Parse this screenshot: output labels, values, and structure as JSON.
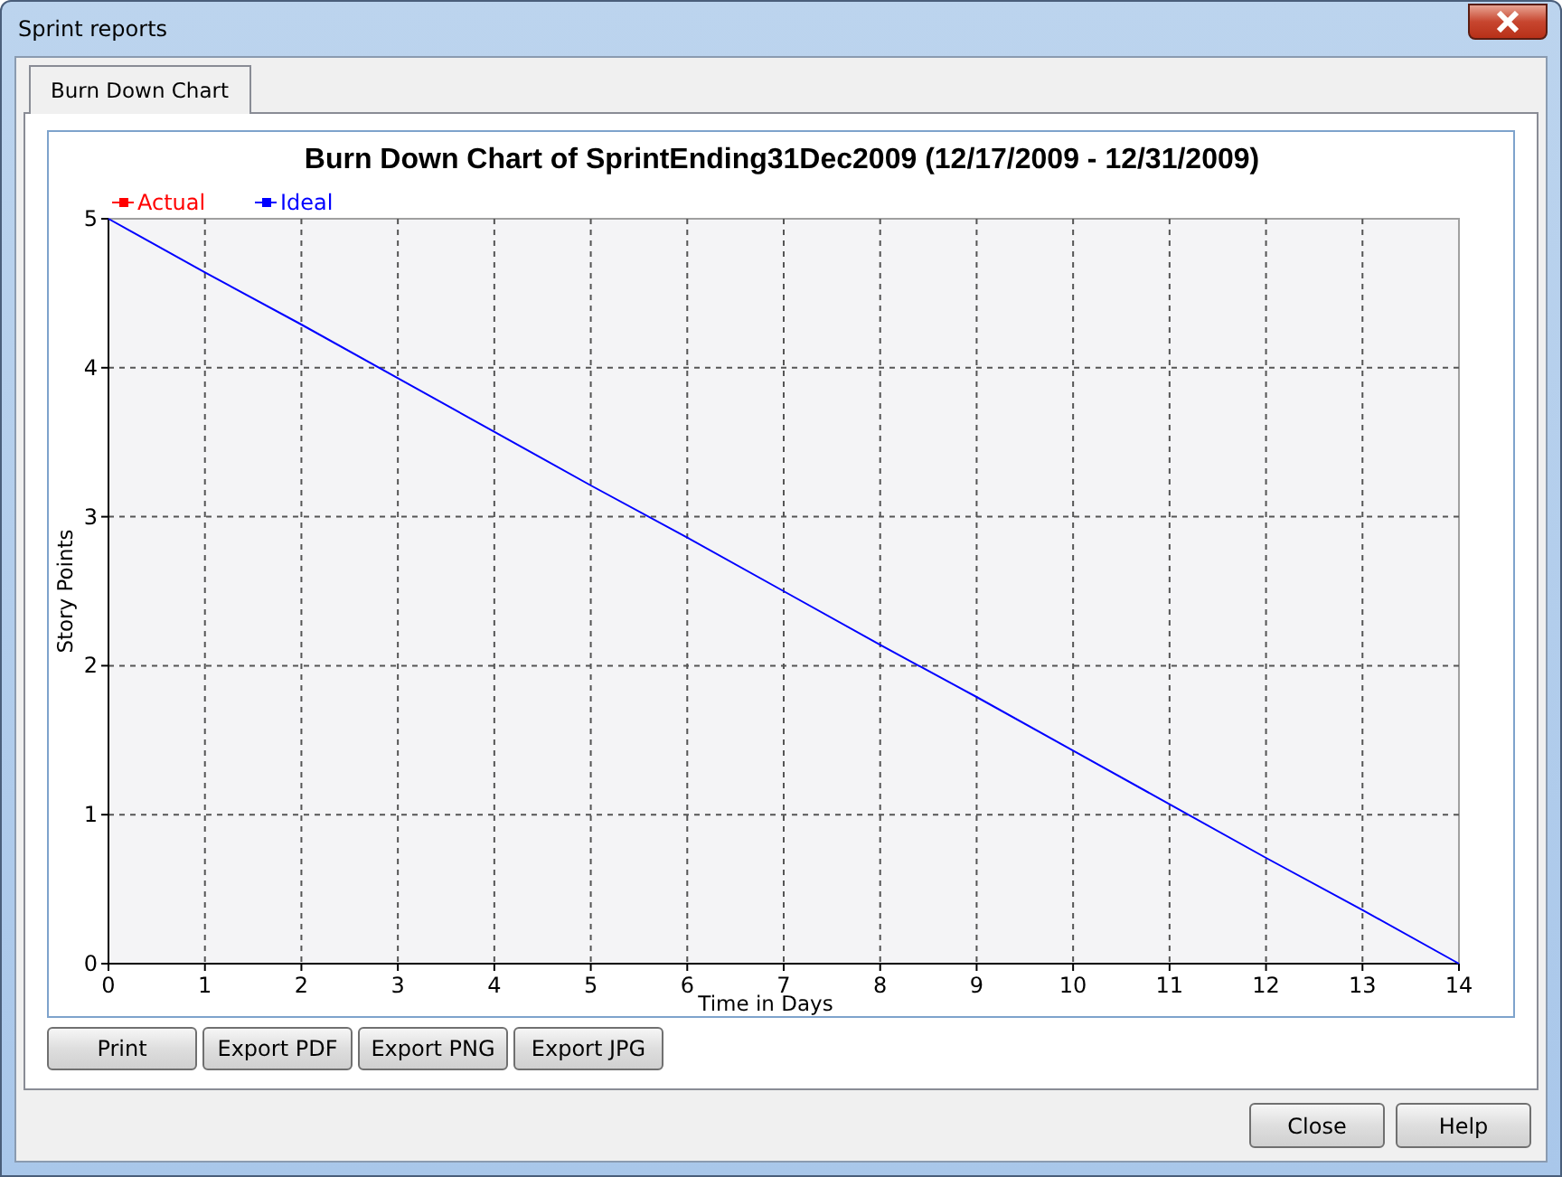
{
  "window": {
    "title": "Sprint reports"
  },
  "tabs": [
    {
      "label": "Burn Down Chart",
      "selected": true
    }
  ],
  "chart_data": {
    "type": "line",
    "title": "Burn Down Chart of SprintEnding31Dec2009 (12/17/2009 - 12/31/2009)",
    "xlabel": "Time in Days",
    "ylabel": "Story Points",
    "x": [
      0,
      1,
      2,
      3,
      4,
      5,
      6,
      7,
      8,
      9,
      10,
      11,
      12,
      13,
      14
    ],
    "series": [
      {
        "name": "Actual",
        "color": "#ff0000",
        "values": [
          null,
          null,
          null,
          null,
          null,
          null,
          null,
          null,
          null,
          null,
          null,
          null,
          null,
          null,
          null
        ]
      },
      {
        "name": "Ideal",
        "color": "#0000ff",
        "values": [
          5,
          4.64,
          4.29,
          3.93,
          3.57,
          3.21,
          2.86,
          2.5,
          2.14,
          1.79,
          1.43,
          1.07,
          0.71,
          0.36,
          0
        ]
      }
    ],
    "xlim": [
      0,
      14
    ],
    "ylim": [
      0,
      5
    ],
    "xticks": [
      0,
      1,
      2,
      3,
      4,
      5,
      6,
      7,
      8,
      9,
      10,
      11,
      12,
      13,
      14
    ],
    "yticks": [
      0,
      1,
      2,
      3,
      4,
      5
    ],
    "grid": true
  },
  "export_buttons": [
    "Print",
    "Export PDF",
    "Export PNG",
    "Export JPG"
  ],
  "buttons": [
    "Close",
    "Help"
  ]
}
